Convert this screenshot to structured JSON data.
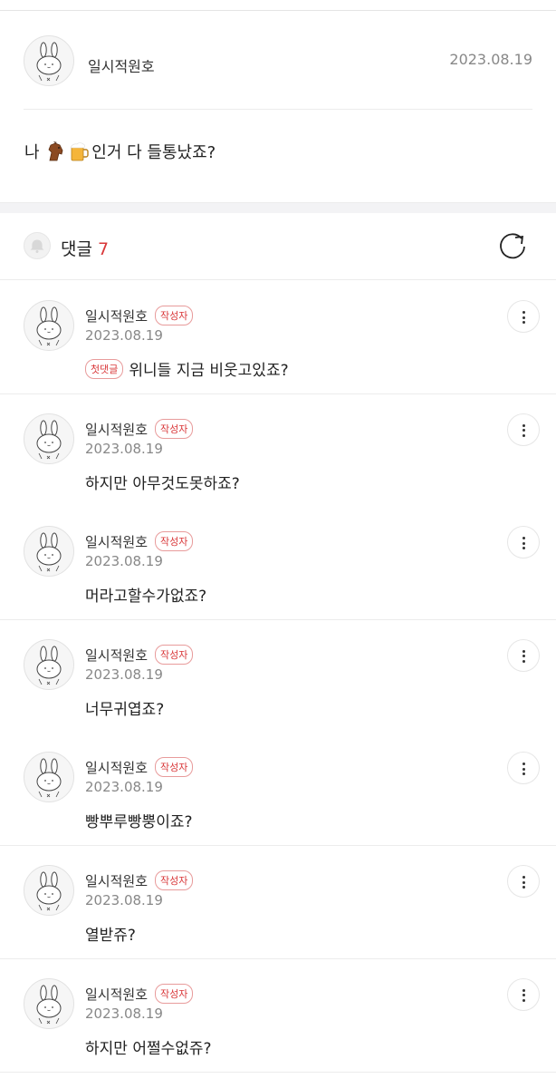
{
  "post": {
    "author": "일시적원호",
    "date": "2023.08.19",
    "text_prefix": "나 ",
    "text_suffix": "인거 다 들통났죠?",
    "emojis": [
      "horse-emoji",
      "beer-emoji"
    ]
  },
  "comments_header": {
    "title": "댓글",
    "count": "7"
  },
  "comments": [
    {
      "author": "일시적원호",
      "badge": "작성자",
      "date": "2023.08.19",
      "first_badge": "첫댓글",
      "text": "위니들 지금 비웃고있죠?"
    },
    {
      "author": "일시적원호",
      "badge": "작성자",
      "date": "2023.08.19",
      "text": "하지만 아무것도못하죠?"
    },
    {
      "author": "일시적원호",
      "badge": "작성자",
      "date": "2023.08.19",
      "text": "머라고할수가없죠?"
    },
    {
      "author": "일시적원호",
      "badge": "작성자",
      "date": "2023.08.19",
      "text": "너무귀엽죠?"
    },
    {
      "author": "일시적원호",
      "badge": "작성자",
      "date": "2023.08.19",
      "text": "빵뿌루빵뿡이죠?"
    },
    {
      "author": "일시적원호",
      "badge": "작성자",
      "date": "2023.08.19",
      "text": "열받쥬?"
    },
    {
      "author": "일시적원호",
      "badge": "작성자",
      "date": "2023.08.19",
      "text": "하지만 어쩔수없쥬?"
    }
  ],
  "icons": {
    "avatar": "bunny-avatar-icon",
    "bell": "bell-icon",
    "refresh": "refresh-icon",
    "more": "more-vertical-icon"
  },
  "colors": {
    "accent": "#d9383a",
    "muted": "#888888"
  }
}
